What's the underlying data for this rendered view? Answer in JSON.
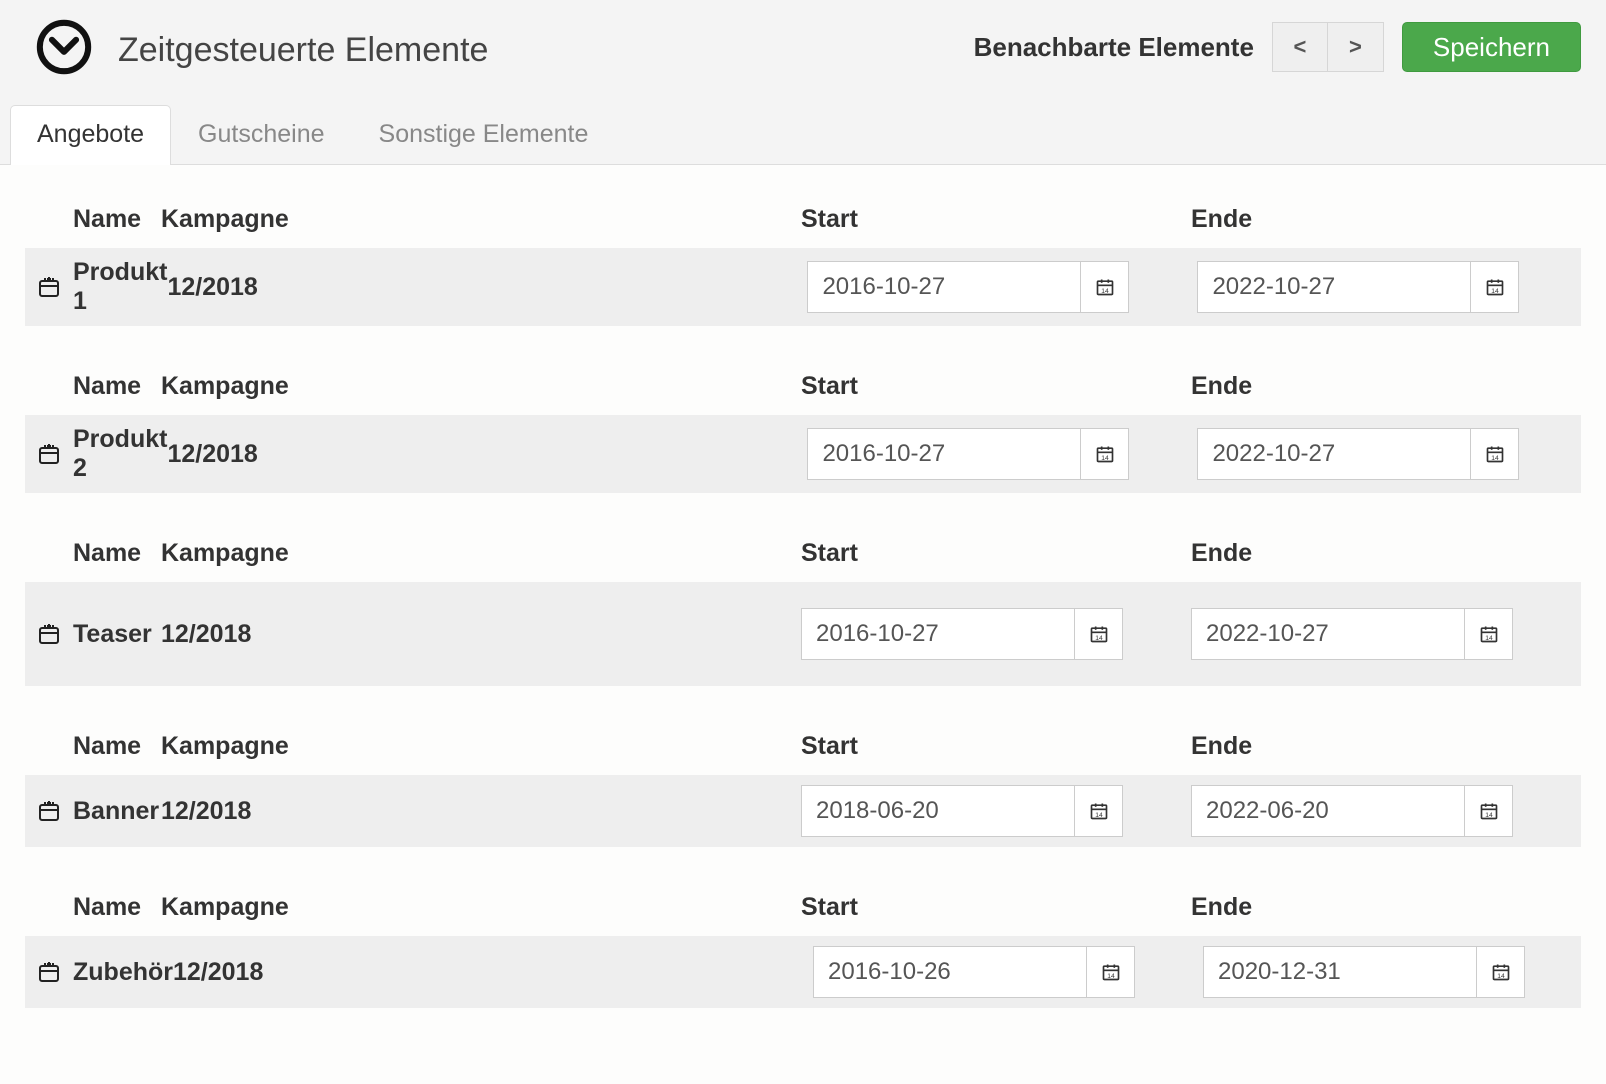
{
  "header": {
    "title": "Zeitgesteuerte Elemente",
    "neighbor_label": "Benachbarte Elemente",
    "prev": "<",
    "next": ">",
    "save": "Speichern"
  },
  "tabs": [
    {
      "label": "Angebote",
      "active": true
    },
    {
      "label": "Gutscheine",
      "active": false
    },
    {
      "label": "Sonstige Elemente",
      "active": false
    }
  ],
  "columns": {
    "name": "Name",
    "campaign": "Kampagne",
    "start": "Start",
    "end": "Ende"
  },
  "rows": [
    {
      "name": "Produkt 1",
      "campaign": "12/2018",
      "start": "2016-10-27",
      "end": "2022-10-27",
      "tall": false
    },
    {
      "name": "Produkt 2",
      "campaign": "12/2018",
      "start": "2016-10-27",
      "end": "2022-10-27",
      "tall": false
    },
    {
      "name": "Teaser",
      "campaign": "12/2018",
      "start": "2016-10-27",
      "end": "2022-10-27",
      "tall": true
    },
    {
      "name": "Banner",
      "campaign": "12/2018",
      "start": "2018-06-20",
      "end": "2022-06-20",
      "tall": false
    },
    {
      "name": "Zubehör",
      "campaign": "12/2018",
      "start": "2016-10-26",
      "end": "2020-12-31",
      "tall": false
    }
  ]
}
